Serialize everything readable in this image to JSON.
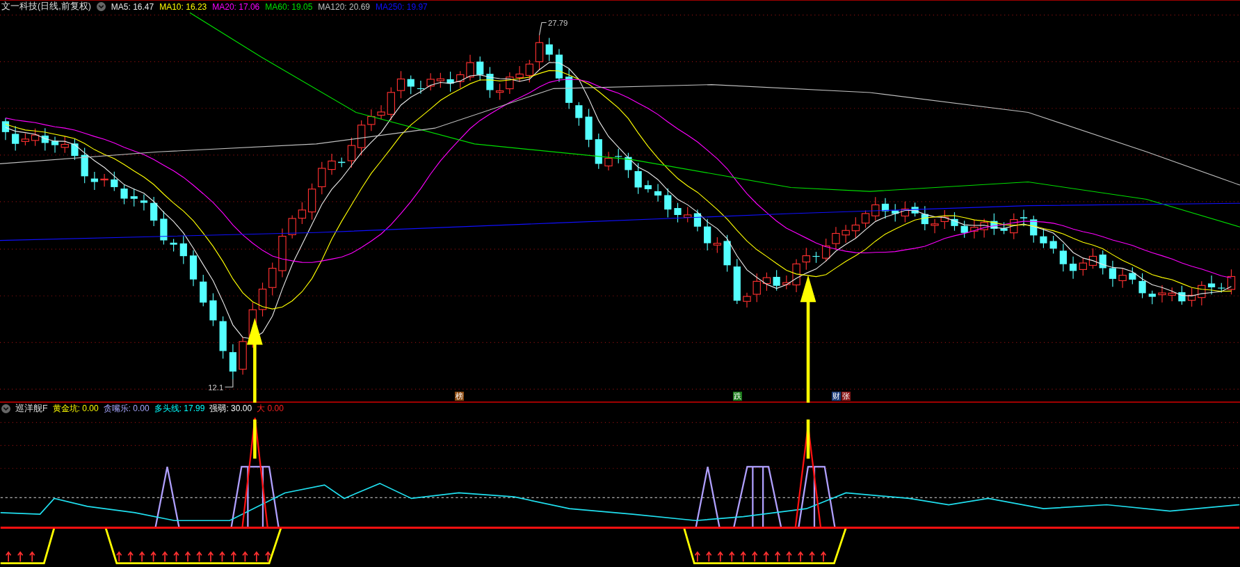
{
  "main_chart": {
    "title": "文一科技(日线,前复权)",
    "ma_legend": [
      {
        "label": "MA5:",
        "value": "16.47",
        "color": "#e8e8e8"
      },
      {
        "label": "MA10:",
        "value": "16.23",
        "color": "#ffff00"
      },
      {
        "label": "MA20:",
        "value": "17.06",
        "color": "#ff00ff"
      },
      {
        "label": "MA60:",
        "value": "19.05",
        "color": "#00e000"
      },
      {
        "label": "MA120:",
        "value": "20.69",
        "color": "#c0c0c0"
      },
      {
        "label": "MA250:",
        "value": "19.97",
        "color": "#1010ff"
      }
    ],
    "high_label": "27.79",
    "low_label": "12.1"
  },
  "signal_tags": [
    {
      "text": "榜",
      "color": "#8b4a10"
    },
    {
      "text": "跌",
      "color": "#1b7a1b"
    },
    {
      "text": "财",
      "color": "#1f3f7a"
    },
    {
      "text": "张",
      "color": "#8a1818"
    }
  ],
  "indicator": {
    "title": "巡洋舰F",
    "legend": [
      {
        "label": "黄金坑:",
        "value": "0.00",
        "color": "#ffff00"
      },
      {
        "label": "贪嘴乐:",
        "value": "0.00",
        "color": "#a8a8ff"
      },
      {
        "label": "多头线:",
        "value": "17.99",
        "color": "#00ffff"
      },
      {
        "label": "强弱:",
        "value": "30.00",
        "color": "#ffffff"
      },
      {
        "label": "大",
        "value": "0.00",
        "color": "#ff2020"
      }
    ]
  }
}
